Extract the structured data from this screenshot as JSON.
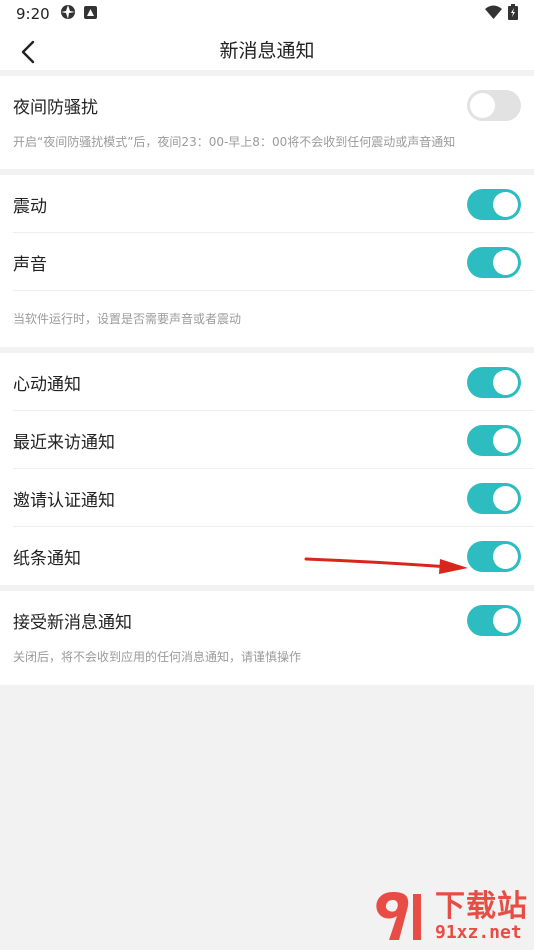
{
  "status_bar": {
    "time": "9:20"
  },
  "nav": {
    "title": "新消息通知"
  },
  "group_night": {
    "label": "夜间防骚扰",
    "enabled": false,
    "hint": "开启“夜间防骚扰模式”后，夜间23：00-早上8：00将不会收到任何震动或声音通知"
  },
  "group_alerts": {
    "vibrate_label": "震动",
    "vibrate_enabled": true,
    "sound_label": "声音",
    "sound_enabled": true,
    "hint": "当软件运行时，设置是否需要声音或者震动"
  },
  "group_types": {
    "items": [
      {
        "label": "心动通知",
        "enabled": true
      },
      {
        "label": "最近来访通知",
        "enabled": true
      },
      {
        "label": "邀请认证通知",
        "enabled": true
      },
      {
        "label": "纸条通知",
        "enabled": true
      }
    ]
  },
  "group_receive": {
    "label": "接受新消息通知",
    "enabled": true,
    "hint": "关闭后，将不会收到应用的任何消息通知，请谨慎操作"
  },
  "watermark": {
    "cn": "下载站",
    "en": "91xz.net"
  },
  "colors": {
    "toggle_on": "#2dbcbf",
    "toggle_off": "#e2e2e2",
    "annotation_arrow": "#d9261c"
  }
}
